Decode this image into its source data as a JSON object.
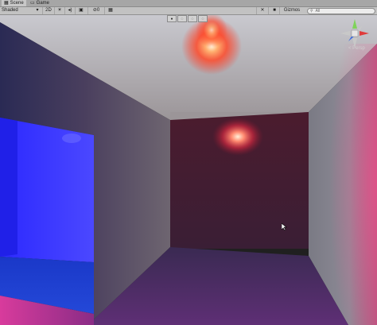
{
  "tabs": [
    {
      "label": "Scene",
      "icon": "scene-icon",
      "glyph": "▦"
    },
    {
      "label": "Game",
      "icon": "game-icon",
      "glyph": "▭"
    }
  ],
  "toolbar": {
    "shading_mode": "Shaded",
    "dropdown_glyph": "▾",
    "mode_2d": "2D",
    "lighting_glyph": "☀",
    "audio_glyph": "◂)",
    "effects_glyph": "▣",
    "hidden_glyph": "⊘",
    "hidden_count": "0",
    "grid_glyph": "▦",
    "tools_glyph": "✕",
    "camera_glyph": "■",
    "gizmos_label": "Gizmos",
    "search_glyph": "⚲",
    "search_placeholder": "All"
  },
  "viewport": {
    "projection_label": "< Persp"
  },
  "scene_overlay": {
    "buttons": [
      "●",
      "◌",
      "◌",
      "◌"
    ]
  },
  "colors": {
    "tab_bar": "#a6a6a6",
    "toolbar": "#c2c2c2",
    "ceiling": "#aeaeae",
    "back_wall": "#462033",
    "left_room_light": "#3737ff",
    "red_light": "#ff5536",
    "magenta_floor": "#b82b86"
  }
}
